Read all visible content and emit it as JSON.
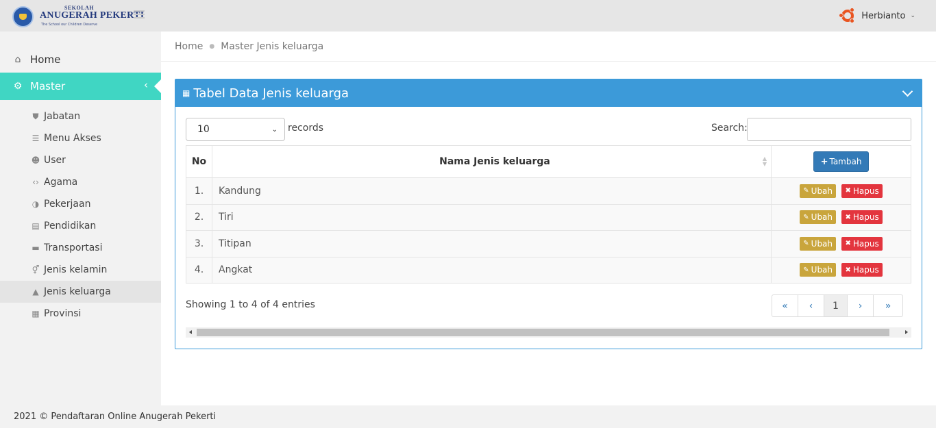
{
  "brand": {
    "school_small": "SEKOLAH",
    "school_name": "ANUGERAH PEKERTI",
    "tagline": "The School our Children Deserve",
    "logo_icon": "school-emblem"
  },
  "user": {
    "name": "Herbianto",
    "avatar_icon": "ubuntu-logo-icon"
  },
  "sidebar": {
    "home": {
      "label": "Home",
      "icon": "home-icon"
    },
    "master": {
      "label": "Master",
      "icon": "cogs-icon"
    },
    "items": [
      {
        "label": "Jabatan",
        "icon": "shield-icon"
      },
      {
        "label": "Menu Akses",
        "icon": "list-icon"
      },
      {
        "label": "User",
        "icon": "users-icon"
      },
      {
        "label": "Agama",
        "icon": "code-icon"
      },
      {
        "label": "Pekerjaan",
        "icon": "adjust-icon"
      },
      {
        "label": "Pendidikan",
        "icon": "book-icon"
      },
      {
        "label": "Transportasi",
        "icon": "car-icon"
      },
      {
        "label": "Jenis kelamin",
        "icon": "gender-icon"
      },
      {
        "label": "Jenis keluarga",
        "icon": "user-icon",
        "active": true
      },
      {
        "label": "Provinsi",
        "icon": "building-icon"
      }
    ]
  },
  "breadcrumb": {
    "home": "Home",
    "current": "Master Jenis keluarga"
  },
  "panel": {
    "title": "Tabel Data Jenis keluarga",
    "length_value": "10",
    "records_label": "records",
    "search_label": "Search:",
    "search_value": "",
    "columns": {
      "no": "No",
      "name": "Nama Jenis keluarga"
    },
    "add_label": "Tambah",
    "edit_label": "Ubah",
    "delete_label": "Hapus",
    "rows": [
      {
        "no": "1.",
        "name": "Kandung"
      },
      {
        "no": "2.",
        "name": "Tiri"
      },
      {
        "no": "3.",
        "name": "Titipan"
      },
      {
        "no": "4.",
        "name": "Angkat"
      }
    ],
    "info": "Showing 1 to 4 of 4 entries",
    "pagination": {
      "first": "«",
      "prev": "‹",
      "current": "1",
      "next": "›",
      "last": "»"
    }
  },
  "footer": {
    "text": "2021 © Pendaftaran Online Anugerah Pekerti"
  },
  "colors": {
    "accent": "#40d6c3",
    "panel": "#3c9ad9",
    "edit": "#c9a53c",
    "delete": "#e3353e",
    "primary": "#337ab7",
    "user_logo": "#e95420"
  }
}
